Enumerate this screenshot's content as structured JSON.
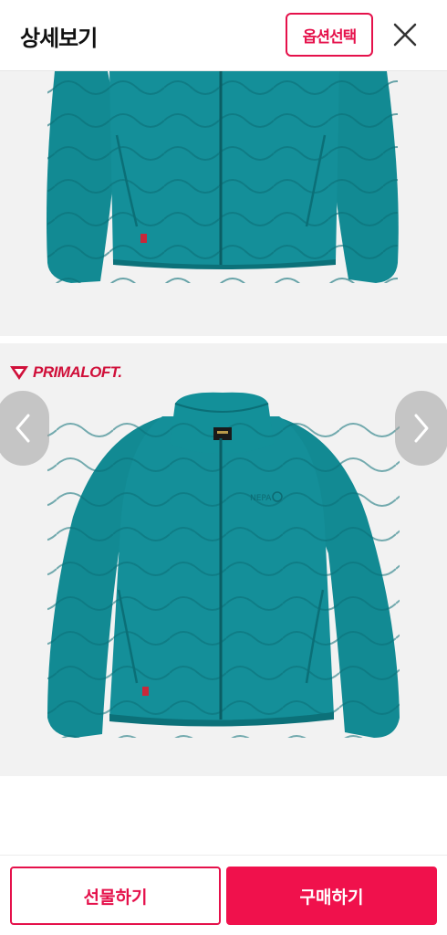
{
  "header": {
    "title": "상세보기",
    "option_button": "옵션선택",
    "close_icon": "close-icon"
  },
  "gallery": {
    "brand_logo_text": "PRIMALOFT.",
    "prev_icon": "chevron-left-icon",
    "next_icon": "chevron-right-icon",
    "jacket_color": "#138d96"
  },
  "actions": {
    "gift_label": "선물하기",
    "buy_label": "구매하기"
  },
  "colors": {
    "accent": "#e5114b",
    "buy_bg": "#f0114c"
  }
}
